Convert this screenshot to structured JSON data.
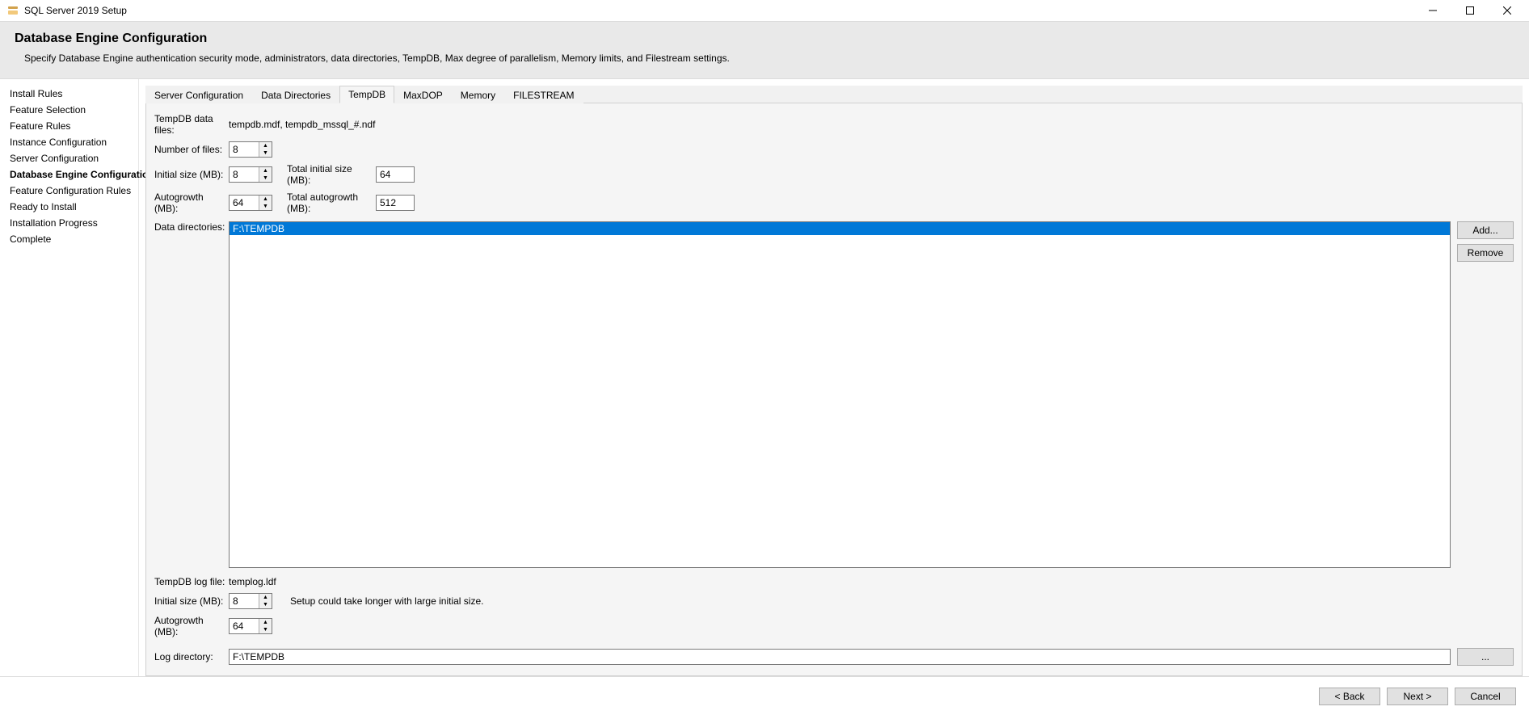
{
  "titlebar": {
    "title": "SQL Server 2019 Setup"
  },
  "header": {
    "title": "Database Engine Configuration",
    "subtitle": "Specify Database Engine authentication security mode, administrators, data directories, TempDB, Max degree of parallelism, Memory limits, and Filestream settings."
  },
  "sidebar": {
    "items": [
      "Install Rules",
      "Feature Selection",
      "Feature Rules",
      "Instance Configuration",
      "Server Configuration",
      "Database Engine Configuration",
      "Feature Configuration Rules",
      "Ready to Install",
      "Installation Progress",
      "Complete"
    ],
    "active_index": 5
  },
  "tabs": {
    "items": [
      "Server Configuration",
      "Data Directories",
      "TempDB",
      "MaxDOP",
      "Memory",
      "FILESTREAM"
    ],
    "active_index": 2
  },
  "form": {
    "data_files_label": "TempDB data files:",
    "data_files_value": "tempdb.mdf, tempdb_mssql_#.ndf",
    "number_of_files_label": "Number of files:",
    "number_of_files_value": "8",
    "initial_size_label": "Initial size (MB):",
    "initial_size_value": "8",
    "total_initial_size_label": "Total initial size (MB):",
    "total_initial_size_value": "64",
    "autogrowth_label": "Autogrowth (MB):",
    "autogrowth_value": "64",
    "total_autogrowth_label": "Total autogrowth (MB):",
    "total_autogrowth_value": "512",
    "data_directories_label": "Data directories:",
    "data_directories_items": [
      "F:\\TEMPDB"
    ],
    "add_button": "Add...",
    "remove_button": "Remove",
    "log_file_label": "TempDB log file:",
    "log_file_value": "templog.ldf",
    "log_initial_size_label": "Initial size (MB):",
    "log_initial_size_value": "8",
    "log_initial_warn": "Setup could take longer with large initial size.",
    "log_autogrowth_label": "Autogrowth (MB):",
    "log_autogrowth_value": "64",
    "log_directory_label": "Log directory:",
    "log_directory_value": "F:\\TEMPDB",
    "browse_button": "..."
  },
  "footer": {
    "back": "< Back",
    "next": "Next >",
    "cancel": "Cancel"
  }
}
